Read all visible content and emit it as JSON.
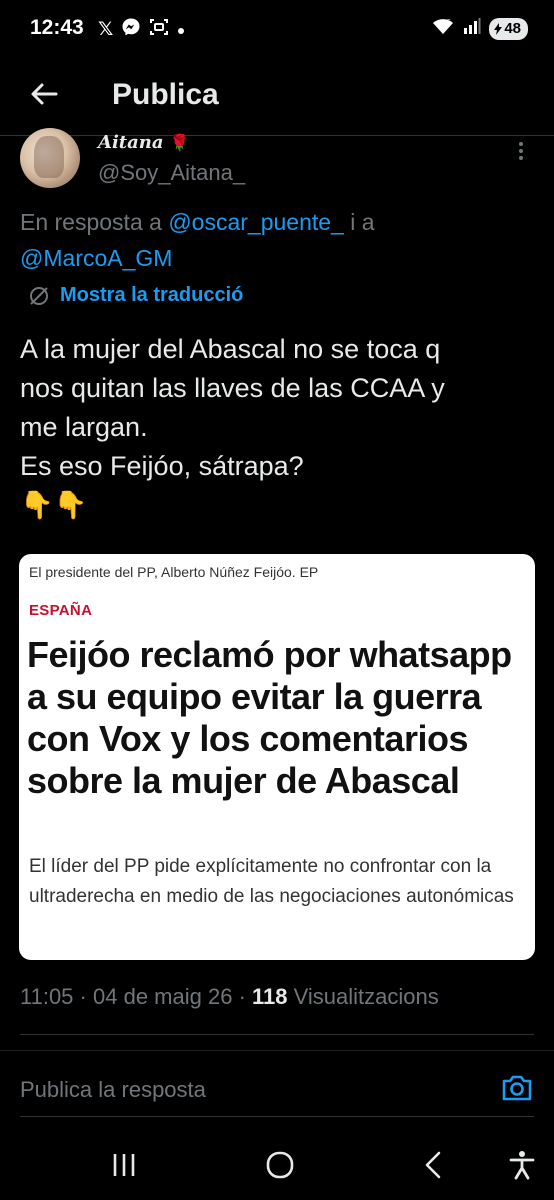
{
  "status_bar": {
    "time": "12:43",
    "icons": [
      "x-icon",
      "messenger-icon",
      "scan-icon",
      "dot-icon"
    ],
    "right_icons": [
      "wifi-icon",
      "signal-icon"
    ],
    "battery": "48"
  },
  "header": {
    "title": "Publica",
    "back_icon": "arrow-left-icon"
  },
  "author": {
    "display_name": "Aitana",
    "emoji": "🌹",
    "handle": "@Soy_Aitana_"
  },
  "reply_to": {
    "prefix": "En resposta a",
    "mention1": "@oscar_puente_",
    "joiner": "i a",
    "mention2": "@MarcoA_GM"
  },
  "translate": {
    "label": "Mostra la traducció",
    "icon": "globe-slash-icon"
  },
  "tweet": {
    "text": "A la mujer del Abascal no se toca q\nnos quitan las llaves de las CCAA y\nme largan.\nEs eso Feijóo, sátrapa?\n👇👇"
  },
  "card": {
    "caption": "El presidente del PP, Alberto Núñez Feijóo. EP",
    "kicker": "ESPAÑA",
    "title": "Feijóo reclamó por whatsapp a su equipo evitar la guerra con Vox y los comentarios sobre la mujer de Abascal",
    "subtitle": "El líder del PP pide explícitamente no confrontar con la ultraderecha en medio de las negociaciones autonómicas"
  },
  "meta": {
    "time": "11:05",
    "date": "04 de maig 26",
    "views_count": "118",
    "views_label": "Visualitzacions"
  },
  "reply_bar": {
    "placeholder": "Publica la resposta",
    "camera_icon": "camera-icon"
  },
  "nav": [
    "recents-icon",
    "home-icon",
    "back-icon",
    "accessibility-icon"
  ],
  "colors": {
    "background": "#000000",
    "accent": "#1d9bf0",
    "muted": "#71767b",
    "text": "#e7e9ea",
    "kicker_red": "#c8102e"
  }
}
